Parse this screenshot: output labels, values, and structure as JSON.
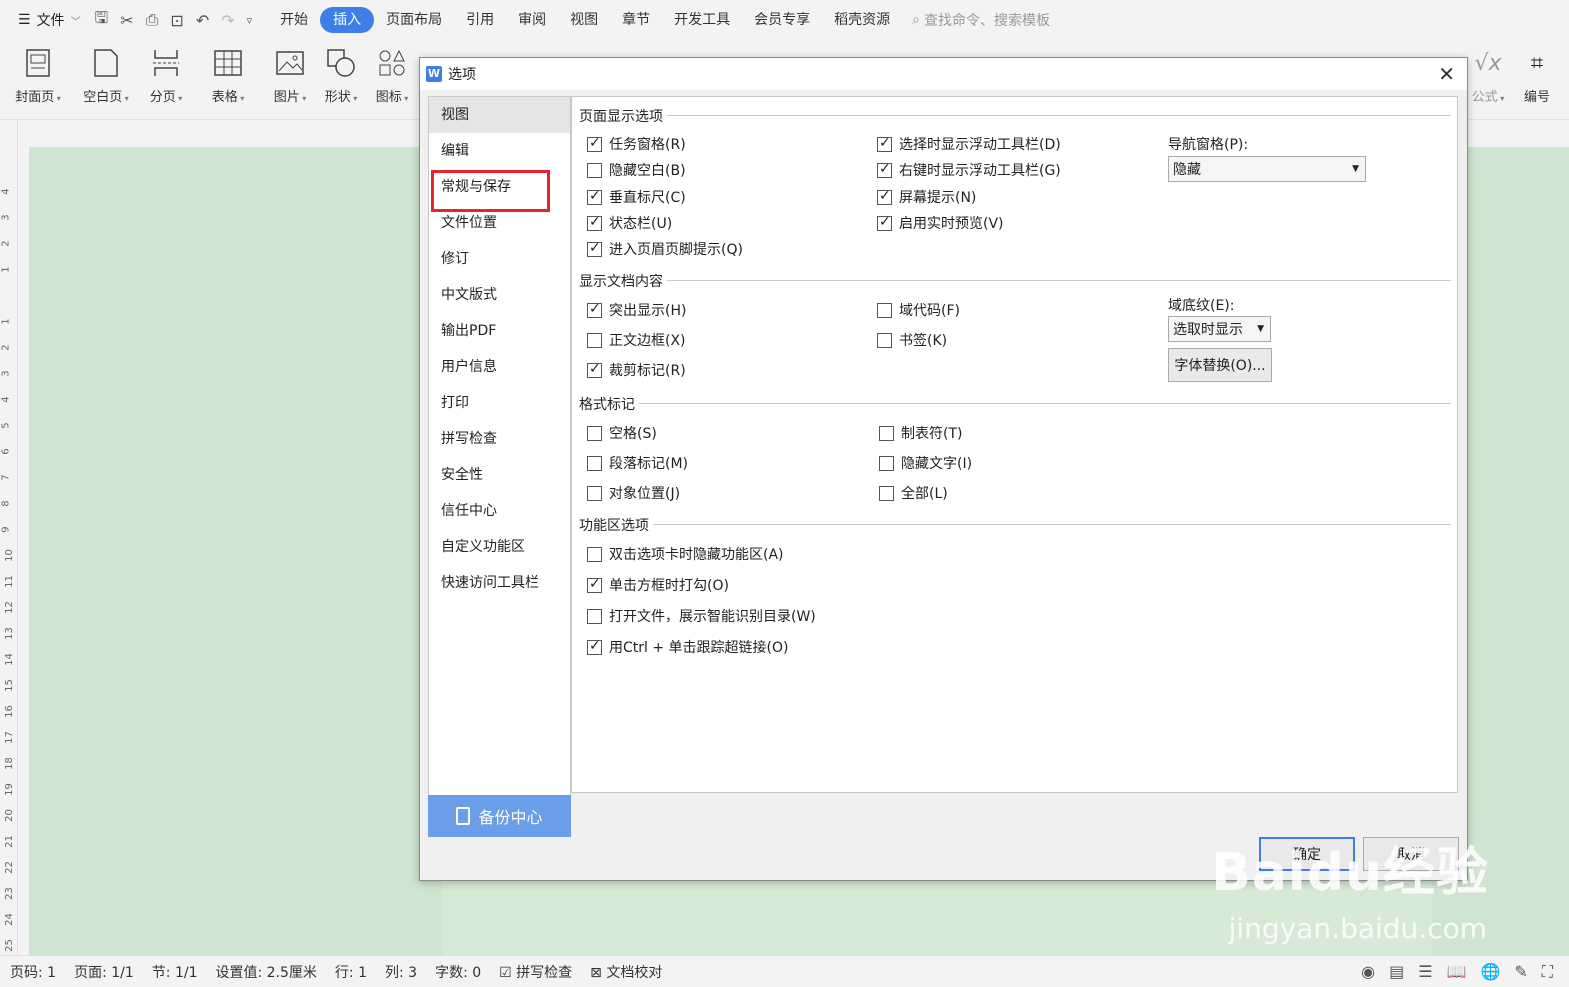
{
  "menubar": {
    "file_label": "文件",
    "tabs": [
      "开始",
      "插入",
      "页面布局",
      "引用",
      "审阅",
      "视图",
      "章节",
      "开发工具",
      "会员专享",
      "稻壳资源"
    ],
    "active_tab": "插入",
    "search_placeholder": "查找命令、搜索模板"
  },
  "ribbon": {
    "buttons": [
      "封面页",
      "空白页",
      "分页",
      "表格",
      "图片",
      "形状",
      "图标"
    ],
    "right_buttons": [
      "公式",
      "编号"
    ]
  },
  "ruler": {
    "numbers": [
      "4",
      "3",
      "2",
      "1",
      "1",
      "2",
      "3",
      "4",
      "5",
      "6",
      "7",
      "8",
      "9",
      "10",
      "11",
      "12",
      "13",
      "14",
      "15",
      "16",
      "17",
      "18",
      "19",
      "20",
      "21",
      "22",
      "23",
      "24",
      "25"
    ]
  },
  "dialog": {
    "title": "选项",
    "nav": [
      "视图",
      "编辑",
      "常规与保存",
      "文件位置",
      "修订",
      "中文版式",
      "输出PDF",
      "用户信息",
      "打印",
      "拼写检查",
      "安全性",
      "信任中心",
      "自定义功能区",
      "快速访问工具栏"
    ],
    "nav_selected": "视图",
    "nav_highlighted": "常规与保存",
    "backup_label": "备份中心",
    "sections": {
      "page_display": {
        "title": "页面显示选项",
        "col1": [
          {
            "label": "任务窗格(R)",
            "checked": true
          },
          {
            "label": "隐藏空白(B)",
            "checked": false
          },
          {
            "label": "垂直标尺(C)",
            "checked": true
          },
          {
            "label": "状态栏(U)",
            "checked": true
          },
          {
            "label": "进入页眉页脚提示(Q)",
            "checked": true
          }
        ],
        "col2": [
          {
            "label": "选择时显示浮动工具栏(D)",
            "checked": true
          },
          {
            "label": "右键时显示浮动工具栏(G)",
            "checked": true
          },
          {
            "label": "屏幕提示(N)",
            "checked": true
          },
          {
            "label": "启用实时预览(V)",
            "checked": true
          }
        ],
        "nav_pane_label": "导航窗格(P):",
        "nav_pane_value": "隐藏"
      },
      "doc_content": {
        "title": "显示文档内容",
        "col1": [
          {
            "label": "突出显示(H)",
            "checked": true
          },
          {
            "label": "正文边框(X)",
            "checked": false
          },
          {
            "label": "裁剪标记(R)",
            "checked": true
          }
        ],
        "col2": [
          {
            "label": "域代码(F)",
            "checked": false
          },
          {
            "label": "书签(K)",
            "checked": false
          }
        ],
        "field_shading_label": "域底纹(E):",
        "field_shading_value": "选取时显示",
        "font_sub_button": "字体替换(O)..."
      },
      "format_marks": {
        "title": "格式标记",
        "col1": [
          {
            "label": "空格(S)",
            "checked": false
          },
          {
            "label": "段落标记(M)",
            "checked": false
          },
          {
            "label": "对象位置(J)",
            "checked": false
          }
        ],
        "col2": [
          {
            "label": "制表符(T)",
            "checked": false
          },
          {
            "label": "隐藏文字(I)",
            "checked": false
          },
          {
            "label": "全部(L)",
            "checked": false
          }
        ]
      },
      "ribbon_opts": {
        "title": "功能区选项",
        "items": [
          {
            "label": "双击选项卡时隐藏功能区(A)",
            "checked": false
          },
          {
            "label": "单击方框时打勾(O)",
            "checked": true
          },
          {
            "label": "打开文件，展示智能识别目录(W)",
            "checked": false
          },
          {
            "label": "用Ctrl + 单击跟踪超链接(O)",
            "checked": true
          }
        ]
      }
    },
    "ok_label": "确定",
    "cancel_label": "取消"
  },
  "statusbar": {
    "items": [
      "页码: 1",
      "页面: 1/1",
      "节: 1/1",
      "设置值: 2.5厘米",
      "行: 1",
      "列: 3",
      "字数: 0",
      "拼写检查",
      "文档校对"
    ]
  },
  "watermark": {
    "brand": "Baidu经验",
    "url": "jingyan.baidu.com"
  }
}
